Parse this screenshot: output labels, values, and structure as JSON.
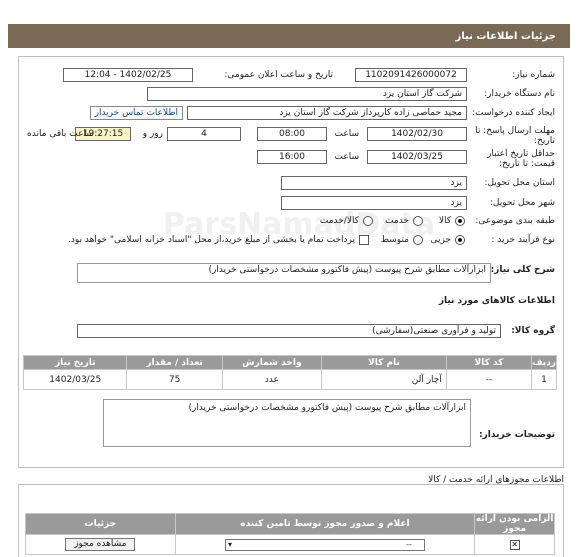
{
  "header": {
    "title": "جزئیات اطلاعات نیاز"
  },
  "watermark": {
    "text": "ParsNamadData"
  },
  "form": {
    "need_number_label": "شماره نیاز:",
    "need_number": "1102091426000072",
    "announce_label": "تاریخ و ساعت اعلان عمومی:",
    "announce_value": "1402/02/25 - 12:04",
    "buyer_org_label": "نام دستگاه خریدار:",
    "buyer_org": "شرکت گاز استان یزد",
    "creator_label": "ایجاد کننده درخواست:",
    "creator": "مجید حماصی زاده کارپرداز شرکت گاز استان یزد",
    "contact_link": "اطلاعات تماس خریدار",
    "deadline_label": "مهلت ارسال پاسخ: تا تاریخ:",
    "deadline_date": "1402/02/30",
    "time_label": "ساعت",
    "deadline_time": "08:00",
    "days": "4",
    "days_label": "روز و",
    "remaining_time": "19:27:15",
    "remaining_label": "ساعت باقی مانده",
    "validity_label": "حداقل تاریخ اعتبار قیمت: تا تاریخ:",
    "validity_date": "1402/03/25",
    "validity_time_label": "ساعت",
    "validity_time": "16:00",
    "province_label": "استان محل تحویل:",
    "province": "یزد",
    "city_label": "شهر محل تحویل:",
    "city": "یزد",
    "category_label": "طبقه بندی موضوعی:",
    "category_options": [
      "کالا",
      "خدمت",
      "کالا/خدمت"
    ],
    "process_label": "نوع فرآیند خرید :",
    "process_options": [
      "جزیی",
      "متوسط"
    ],
    "payment_note": "پرداخت تمام یا بخشی از مبلغ خرید،از محل \"اسناد خزانه اسلامی\" خواهد بود.",
    "description_label": "شرح کلی نیاز:",
    "description": "ابزارآلات مطابق شرح پیوست (پیش فاکتورو مشخصات درخواستی خریدار)",
    "goods_info_label": "اطلاعات کالاهای مورد نیاز",
    "goods_group_label": "گروه کالا:",
    "goods_group": "تولید و فرآوری صنعتی(سفارشی)",
    "buyer_notes_label": "توضیحات خریدار:",
    "buyer_notes": "ابزارآلات مطابق شرح پیوست (پیش فاکتورو مشخصات درخواستی خریدار)"
  },
  "goods_table": {
    "headers": [
      "ردیف",
      "کد کالا",
      "نام کالا",
      "واحد شمارش",
      "تعداد / مقدار",
      "تاریخ نیاز"
    ],
    "rows": [
      {
        "row": "1",
        "code": "--",
        "name": "آچار آلن",
        "unit": "عدد",
        "qty": "75",
        "date": "1402/03/25"
      }
    ]
  },
  "permits": {
    "title": "اطلاعات مجوزهای ارائه خدمت / کالا",
    "headers": [
      "الزامی بودن ارائه مجوز",
      "اعلام و صدور مجوز توسط تامین کننده",
      "جزئیات"
    ],
    "row": {
      "select_value": "--",
      "view_button": "مشاهده مجوز"
    }
  }
}
